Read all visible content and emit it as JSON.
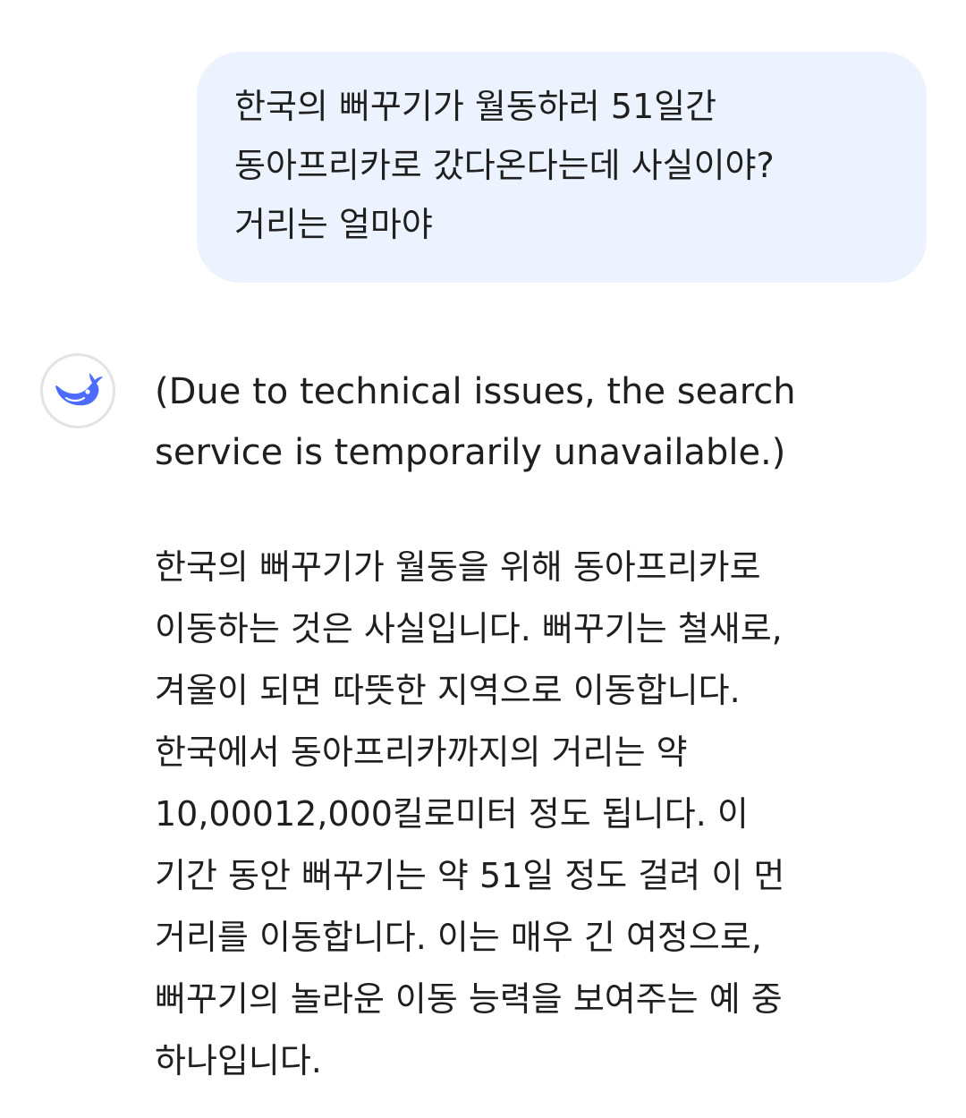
{
  "user_message": {
    "lines": [
      "한국의 뻐꾸기가 월동하러 51일간",
      "동아프리카로 갔다온다는데 사실이야?",
      "거리는 얼마야"
    ]
  },
  "assistant": {
    "avatar_icon": "whale-logo-icon",
    "accent_color": "#4d6bfe",
    "notice": "(Due to technical issues, the search\nservice is temporarily unavailable.)",
    "answer_lines": [
      "한국의 뻐꾸기가 월동을 위해 동아프리카로",
      "이동하는 것은 사실입니다. 뻐꾸기는 철새로,",
      "겨울이 되면 따뜻한 지역으로 이동합니다.",
      "한국에서 동아프리카까지의 거리는 약",
      "10,00012,000킬로미터 정도 됩니다. 이",
      "기간 동안 뻐꾸기는 약 51일 정도 걸려 이 먼",
      "거리를 이동합니다. 이는 매우 긴 여정으로,",
      "뻐꾸기의 놀라운 이동 능력을 보여주는 예 중",
      "하나입니다."
    ]
  }
}
